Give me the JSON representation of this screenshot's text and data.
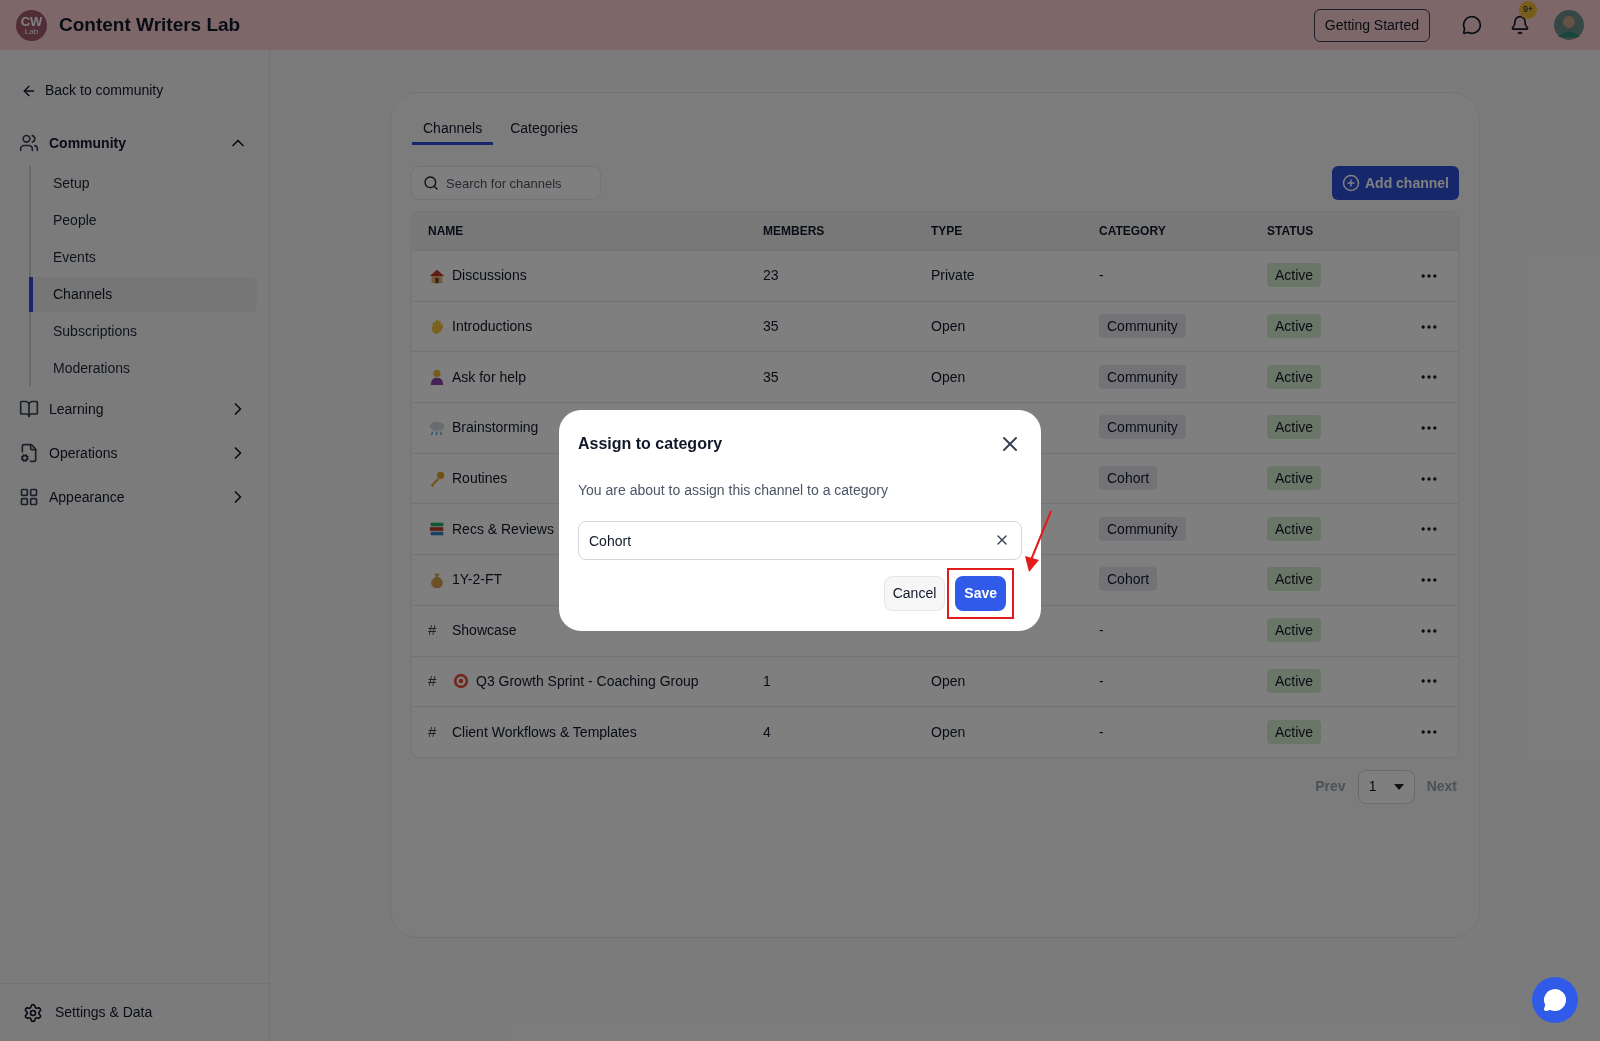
{
  "topbar": {
    "logo": "CW",
    "logo_sub": "Lab",
    "title": "Content Writers Lab",
    "getting_started": "Getting Started",
    "notification_badge": "9+"
  },
  "sidebar": {
    "back": "Back to community",
    "sections": [
      {
        "label": "Community",
        "expanded": true,
        "children": [
          {
            "label": "Setup",
            "selected": false
          },
          {
            "label": "People",
            "selected": false
          },
          {
            "label": "Events",
            "selected": false
          },
          {
            "label": "Channels",
            "selected": true
          },
          {
            "label": "Subscriptions",
            "selected": false
          },
          {
            "label": "Moderations",
            "selected": false
          }
        ]
      },
      {
        "label": "Learning",
        "expanded": false
      },
      {
        "label": "Operations",
        "expanded": false
      },
      {
        "label": "Appearance",
        "expanded": false
      }
    ],
    "footer": "Settings & Data"
  },
  "tabs": [
    {
      "label": "Channels",
      "selected": true
    },
    {
      "label": "Categories",
      "selected": false
    }
  ],
  "search": {
    "placeholder": "Search for channels"
  },
  "add_button": "Add channel",
  "table": {
    "columns": [
      "NAME",
      "MEMBERS",
      "TYPE",
      "CATEGORY",
      "STATUS"
    ],
    "rows": [
      {
        "name": "Discussions",
        "members": "23",
        "type": "Private",
        "category": {
          "kind": "text",
          "label": "-"
        },
        "status": "Active"
      },
      {
        "name": "Introductions",
        "members": "35",
        "type": "Open",
        "category": {
          "kind": "chip",
          "label": "Community"
        },
        "status": "Active"
      },
      {
        "name": "Ask for help",
        "members": "35",
        "type": "Open",
        "category": {
          "kind": "chip",
          "label": "Community"
        },
        "status": "Active"
      },
      {
        "name": "Brainstorming",
        "category": {
          "kind": "chip",
          "label": "Community"
        },
        "status": "Active"
      },
      {
        "name": "Routines",
        "category": {
          "kind": "chip",
          "label": "Cohort"
        },
        "status": "Active"
      },
      {
        "name": "Recs & Reviews",
        "category": {
          "kind": "chip",
          "label": "Community"
        },
        "status": "Active"
      },
      {
        "name": "1Y-2-FT",
        "category": {
          "kind": "chip",
          "label": "Cohort"
        },
        "status": "Active"
      },
      {
        "hash": "#",
        "name": "Showcase",
        "category": {
          "kind": "text",
          "label": "-"
        },
        "status": "Active"
      },
      {
        "hash": "#",
        "name": "Q3 Growth Sprint - Coaching Group",
        "members": "1",
        "type": "Open",
        "category": {
          "kind": "text",
          "label": "-"
        },
        "status": "Active"
      },
      {
        "hash": "#",
        "name": "Client Workflows & Templates",
        "members": "4",
        "type": "Open",
        "category": {
          "kind": "text",
          "label": "-"
        },
        "status": "Active"
      }
    ]
  },
  "pagination": {
    "prev": "Prev",
    "page": "1",
    "next": "Next"
  },
  "dialog": {
    "title": "Assign to category",
    "message": "You are about to assign this channel to a category",
    "value": "Cohort",
    "cancel": "Cancel",
    "save": "Save",
    "highlight": true
  }
}
